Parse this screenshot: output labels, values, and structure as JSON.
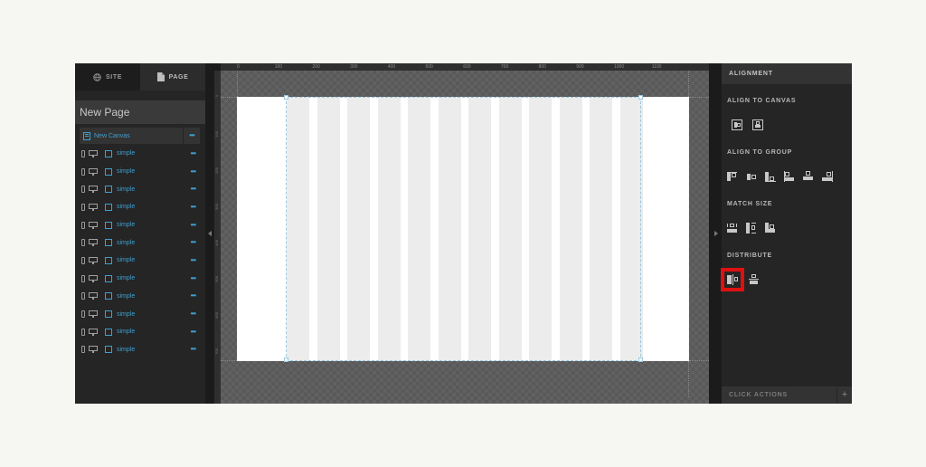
{
  "left_panel": {
    "tabs": [
      {
        "label": "SITE",
        "icon": "globe-icon",
        "active": false
      },
      {
        "label": "PAGE",
        "icon": "page-icon",
        "active": true
      }
    ],
    "page_title": "New Page",
    "canvas_item": {
      "label": "New Canvas",
      "icon": "canvas-icon",
      "more": "•••"
    },
    "items": [
      {
        "label": "simple",
        "more": "•••"
      },
      {
        "label": "simple",
        "more": "•••"
      },
      {
        "label": "simple",
        "more": "•••"
      },
      {
        "label": "simple",
        "more": "•••"
      },
      {
        "label": "simple",
        "more": "•••"
      },
      {
        "label": "simple",
        "more": "•••"
      },
      {
        "label": "simple",
        "more": "•••"
      },
      {
        "label": "simple",
        "more": "•••"
      },
      {
        "label": "simple",
        "more": "•••"
      },
      {
        "label": "simple",
        "more": "•••"
      },
      {
        "label": "simple",
        "more": "•••"
      },
      {
        "label": "simple",
        "more": "•••"
      }
    ]
  },
  "canvas": {
    "h_ruler_labels": [
      "0",
      "100",
      "200",
      "300",
      "400",
      "500",
      "600",
      "700",
      "800",
      "900",
      "1000",
      "1100"
    ],
    "v_ruler_labels": [
      "0",
      "100",
      "200",
      "300",
      "400",
      "500",
      "600",
      "700"
    ],
    "grid_columns": 12
  },
  "right_panel": {
    "header": "ALIGNMENT",
    "sections": {
      "align_to_canvas": "ALIGN TO CANVAS",
      "align_to_group": "ALIGN TO GROUP",
      "match_size": "MATCH SIZE",
      "distribute": "DISTRIBUTE"
    },
    "click_actions": {
      "label": "CLICK ACTIONS",
      "add": "+"
    },
    "highlight_color": "#e01010",
    "highlighted_control": "distribute-horizontal"
  },
  "colors": {
    "accent": "#3f9fcf",
    "panel_bg": "#252525",
    "artboard_column": "#ececec"
  }
}
